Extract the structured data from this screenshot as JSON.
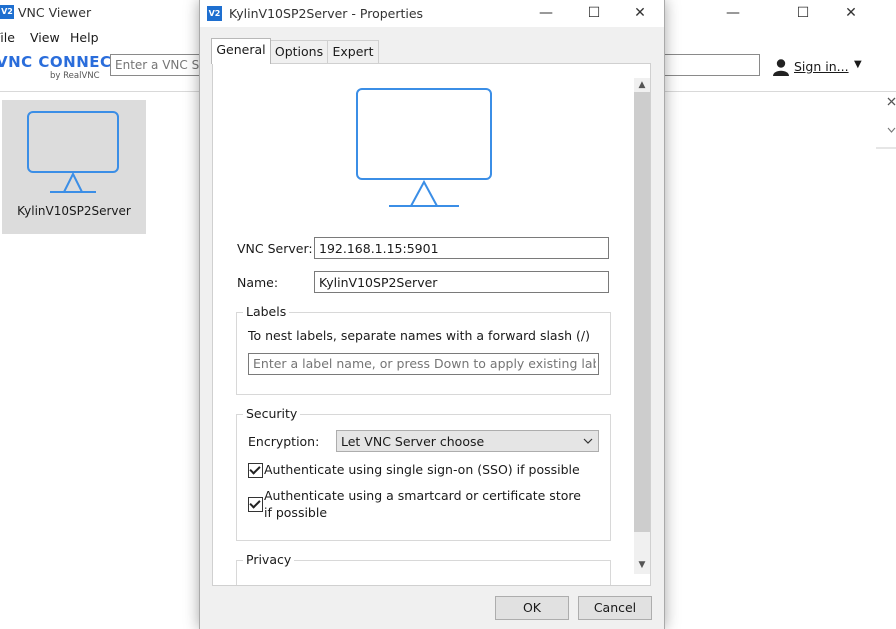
{
  "viewer": {
    "logo_glyph": "V2",
    "title": "VNC Viewer",
    "menu": [
      "File",
      "View",
      "Help"
    ],
    "brand_name": "VNC CONNECT",
    "brand_sub": "by RealVNC",
    "search_placeholder": "Enter a VNC Server address or search",
    "sign_in_label": "Sign in...",
    "tile": {
      "name": "KylinV10SP2Server"
    }
  },
  "dialog": {
    "logo_glyph": "V2",
    "title": "KylinV10SP2Server - Properties",
    "tabs": [
      {
        "label": "General"
      },
      {
        "label": "Options"
      },
      {
        "label": "Expert"
      }
    ],
    "server_label": "VNC Server:",
    "server_value": "192.168.1.15:5901",
    "name_label": "Name:",
    "name_value": "KylinV10SP2Server",
    "labels_group": {
      "title": "Labels",
      "hint": "To nest labels, separate names with a forward slash (/)",
      "input_placeholder": "Enter a label name, or press Down to apply existing labels"
    },
    "security_group": {
      "title": "Security",
      "encryption_label": "Encryption:",
      "encryption_value": "Let VNC Server choose",
      "sso_label": "Authenticate using single sign-on (SSO) if possible",
      "smartcard_label": "Authenticate using a smartcard or certificate store if possible"
    },
    "privacy_group": {
      "title": "Privacy"
    },
    "ok_label": "OK",
    "cancel_label": "Cancel"
  },
  "colors": {
    "accent": "#3b8ee6",
    "tile_bg": "#dcdcdc"
  }
}
